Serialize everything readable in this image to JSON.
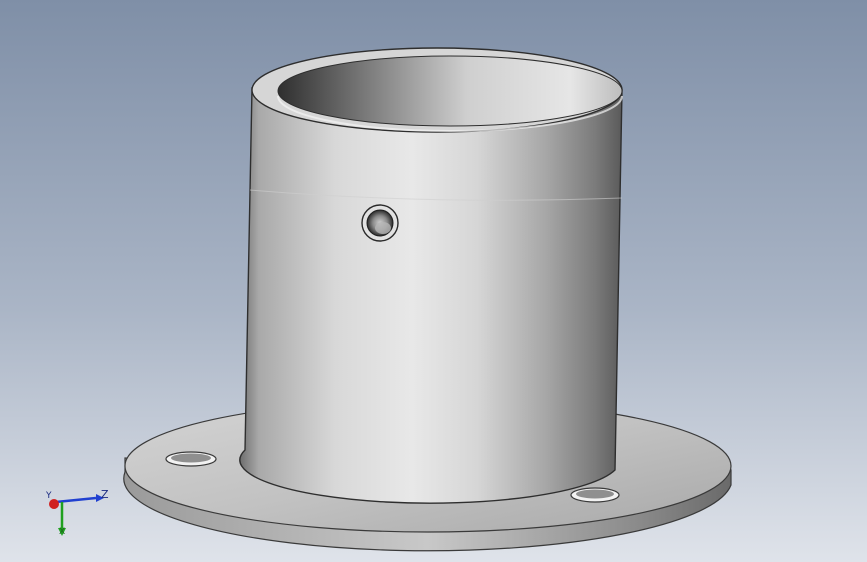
{
  "viewport": {
    "title": "",
    "background_top": "#7e8ea6",
    "background_bottom": "#d8dde6"
  },
  "model": {
    "name": "flange-tube",
    "color": "#c9c9c9",
    "features": [
      "tube-cylinder",
      "tube-bore",
      "side-hole",
      "base-flange",
      "flange-hole-left",
      "flange-hole-right"
    ]
  },
  "triad": {
    "z_label": "Z",
    "y_label": "Y",
    "x_label": "X",
    "x_color": "#d02020",
    "y_color": "#20a020",
    "z_color": "#2040d0"
  }
}
